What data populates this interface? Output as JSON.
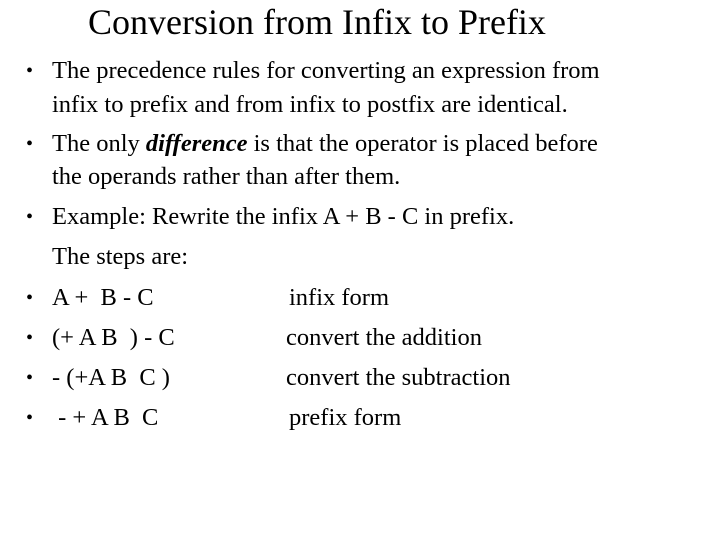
{
  "slide": {
    "title": "Conversion from Infix to Prefix",
    "bullet_glyph": "•",
    "points": [
      {
        "lines": [
          "The precedence rules for converting an expression from",
          "infix to prefix and from infix to postfix are identical."
        ]
      },
      {
        "line1_before": "The only ",
        "line1_emphasis": "difference",
        "line1_after": " is that the operator is placed before",
        "line2": "the operands rather than after them."
      },
      {
        "lines": [
          "Example: Rewrite the infix  A + B - C in prefix.",
          "The steps are:"
        ]
      }
    ],
    "steps": [
      {
        "expression": "A +  B - C",
        "description": "infix form"
      },
      {
        "expression": "(+ A B  ) - C",
        "description": "convert the addition"
      },
      {
        "expression": "- (+A B  C )",
        "description": "convert the subtraction"
      },
      {
        "expression": " - + A B  C",
        "description": "prefix form"
      }
    ]
  }
}
